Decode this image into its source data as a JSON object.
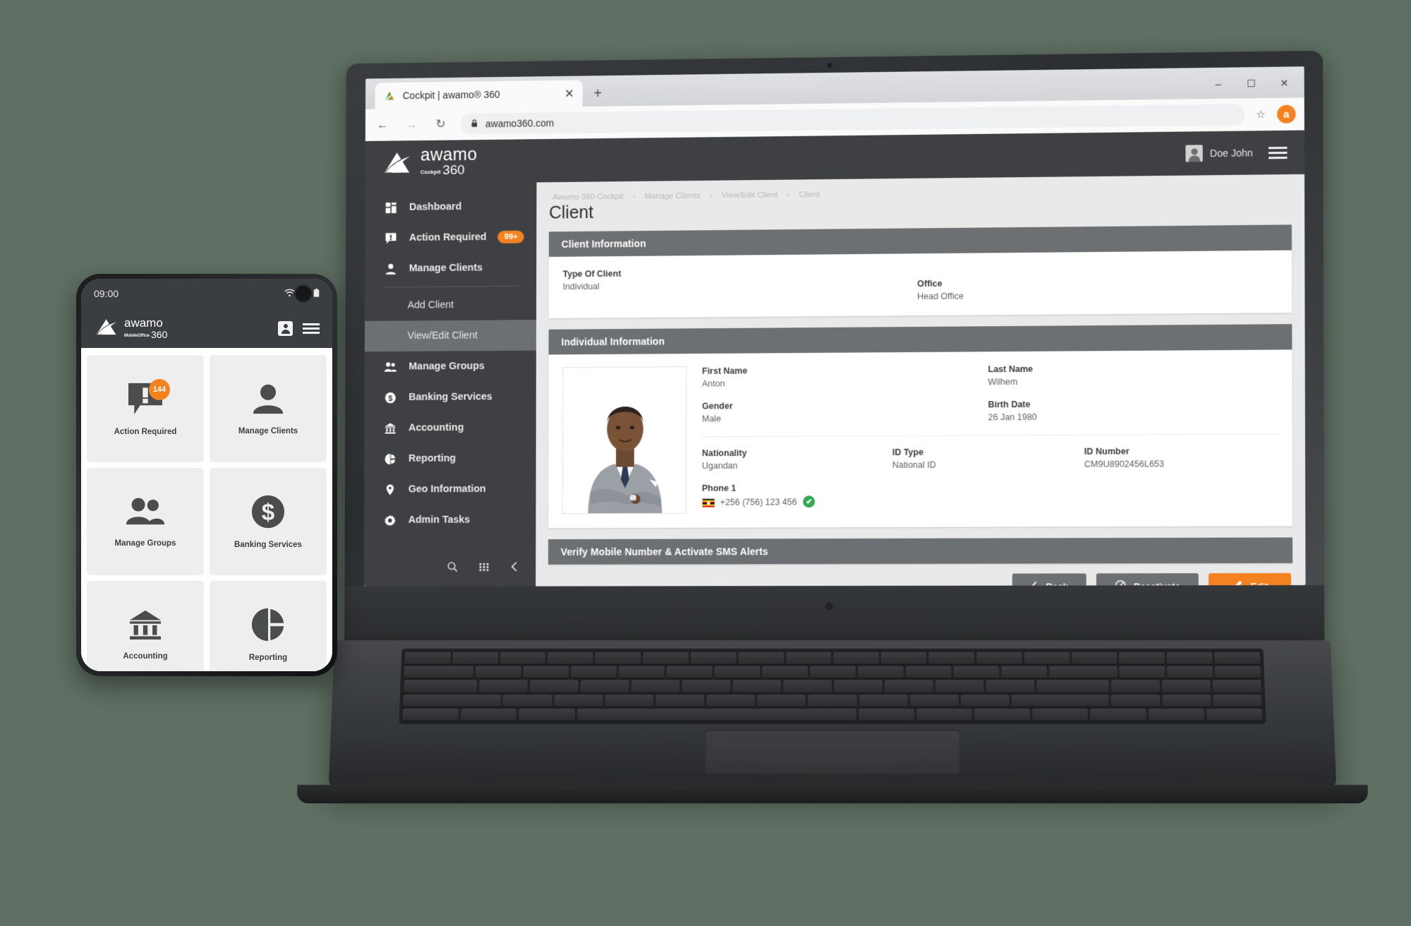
{
  "browser": {
    "tab_title": "Cockpit | awamo® 360",
    "tab_close_icon": "close-icon",
    "new_tab_icon": "plus-icon",
    "back_icon": "arrow-left-icon",
    "forward_icon": "arrow-right-icon",
    "reload_icon": "reload-icon",
    "lock_icon": "lock-icon",
    "url": "awamo360.com",
    "bookmark_icon": "star-icon",
    "profile_initial": "a",
    "minimize_icon": "minimize-icon",
    "maximize_icon": "maximize-icon",
    "close_window_icon": "close-window-icon"
  },
  "app": {
    "brand": {
      "name": "awamo",
      "sub_small": "Cockpit",
      "sub_number": "360"
    },
    "user": {
      "name": "Doe John",
      "avatar_icon": "avatar-icon"
    },
    "menu_icon": "hamburger-menu-icon"
  },
  "sidebar": {
    "items": [
      {
        "label": "Dashboard",
        "icon": "dashboard-icon"
      },
      {
        "label": "Action Required",
        "icon": "alert-message-icon",
        "badge": "99+"
      },
      {
        "label": "Manage Clients",
        "icon": "person-icon"
      }
    ],
    "sub_items": [
      {
        "label": "Add Client",
        "active": false
      },
      {
        "label": "View/Edit Client",
        "active": true
      }
    ],
    "items_after": [
      {
        "label": "Manage Groups",
        "icon": "people-icon"
      },
      {
        "label": "Banking Services",
        "icon": "dollar-circle-icon"
      },
      {
        "label": "Accounting",
        "icon": "bank-icon"
      },
      {
        "label": "Reporting",
        "icon": "pie-chart-icon"
      },
      {
        "label": "Geo Information",
        "icon": "map-pin-icon"
      },
      {
        "label": "Admin Tasks",
        "icon": "gear-icon"
      }
    ],
    "tools": [
      {
        "icon": "search-icon",
        "glyph": "⌕"
      },
      {
        "icon": "grid-icon",
        "glyph": "☷"
      },
      {
        "icon": "collapse-left-icon",
        "glyph": "‹"
      }
    ]
  },
  "page": {
    "breadcrumb": [
      "Awamo 360 Cockpit",
      "Manage Clients",
      "View/Edit Client",
      "Client"
    ],
    "breadcrumb_separator": "›",
    "title": "Client"
  },
  "client_information": {
    "header": "Client Information",
    "fields": [
      {
        "label": "Type Of Client",
        "value": "Individual"
      },
      {
        "label": "Office",
        "value": "Head Office"
      }
    ]
  },
  "individual_information": {
    "header": "Individual Information",
    "photo_alt": "client-photo",
    "first_name": {
      "label": "First Name",
      "value": "Anton"
    },
    "last_name": {
      "label": "Last Name",
      "value": "Wilhem"
    },
    "gender": {
      "label": "Gender",
      "value": "Male"
    },
    "birth_date": {
      "label": "Birth Date",
      "value": "26 Jan 1980"
    },
    "nationality": {
      "label": "Nationality",
      "value": "Ugandan"
    },
    "id_type": {
      "label": "ID Type",
      "value": "National ID"
    },
    "id_number": {
      "label": "ID Number",
      "value": "CM9U8902456L653"
    },
    "phone1": {
      "label": "Phone 1",
      "value": "+256 (756) 123 456",
      "flag_icon": "uganda-flag-icon",
      "verified_icon": "verified-check-icon",
      "verified_mark": "✔"
    }
  },
  "verify_section": {
    "header": "Verify Mobile Number & Activate SMS Alerts"
  },
  "actions": [
    {
      "label": "Back",
      "icon": "chevron-left-icon",
      "glyph": "‹",
      "style": "secondary"
    },
    {
      "label": "Deactivate",
      "icon": "no-entry-icon",
      "glyph": "⊘",
      "style": "secondary"
    },
    {
      "label": "Edit",
      "icon": "pencil-icon",
      "glyph": "✎",
      "style": "primary"
    }
  ],
  "phone": {
    "status": {
      "time": "09:00",
      "wifi_icon": "wifi-icon",
      "signal_icon": "signal-icon",
      "battery_icon": "battery-icon"
    },
    "brand": {
      "name": "awamo",
      "sub_small": "MobileOffice",
      "sub_number": "360"
    },
    "contact_icon": "contact-card-icon",
    "menu_icon": "hamburger-menu-icon",
    "tiles": [
      {
        "label": "Action Required",
        "icon": "alert-message-icon",
        "badge": "144"
      },
      {
        "label": "Manage Clients",
        "icon": "person-icon"
      },
      {
        "label": "Manage Groups",
        "icon": "people-icon"
      },
      {
        "label": "Banking Services",
        "icon": "dollar-circle-icon"
      },
      {
        "label": "Accounting",
        "icon": "bank-icon"
      },
      {
        "label": "Reporting",
        "icon": "pie-chart-icon"
      },
      {
        "label": "",
        "icon": ""
      }
    ]
  },
  "colors": {
    "accent_orange": "#F58220",
    "dark_chrome": "#3e4043",
    "panel_header": "#6d7073",
    "verified_green": "#34A853",
    "page_background": "#e9e9e9"
  }
}
